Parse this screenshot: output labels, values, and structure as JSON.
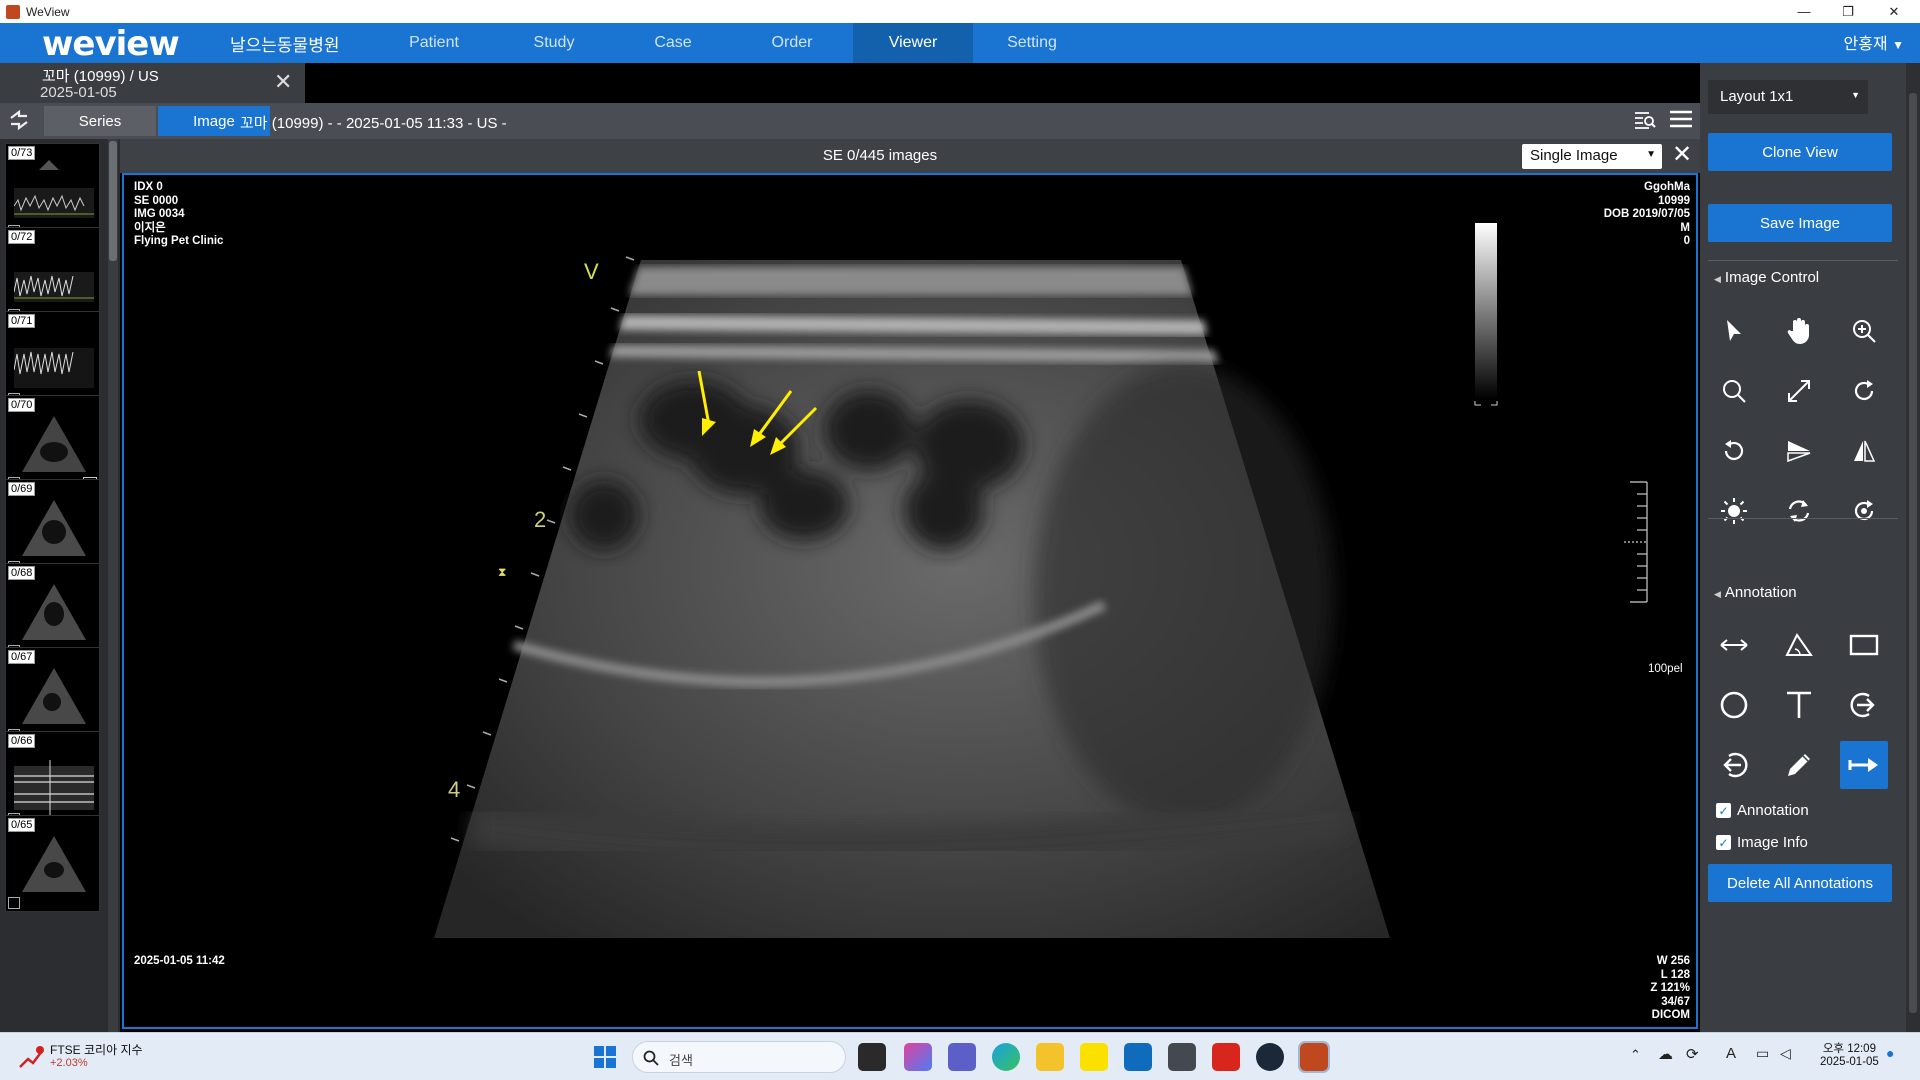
{
  "window": {
    "title": "WeView",
    "min": "—",
    "max": "❐",
    "close": "✕"
  },
  "nav": {
    "logo": "weview",
    "hospital": "날으는동물병원",
    "items": [
      {
        "label": "Patient"
      },
      {
        "label": "Study"
      },
      {
        "label": "Case"
      },
      {
        "label": "Order"
      },
      {
        "label": "Viewer"
      },
      {
        "label": "Setting"
      }
    ],
    "active": "Viewer",
    "user": "안홍재"
  },
  "study_tab": {
    "patient": "꼬마 (10999) / US",
    "date": "2025-01-05",
    "close": "✕"
  },
  "toolbar": {
    "tab_series": "Series",
    "tab_image": "Image",
    "title": "꼬마 (10999) -  - 2025-01-05 11:33 - US -"
  },
  "thumbnails": [
    {
      "label": "0/73",
      "kind": "doppler"
    },
    {
      "label": "0/72",
      "kind": "doppler"
    },
    {
      "label": "0/71",
      "kind": "doppler"
    },
    {
      "label": "0/70",
      "kind": "sector"
    },
    {
      "label": "0/69",
      "kind": "sector"
    },
    {
      "label": "0/68",
      "kind": "sector"
    },
    {
      "label": "0/67",
      "kind": "sector"
    },
    {
      "label": "0/66",
      "kind": "mmode"
    },
    {
      "label": "0/65",
      "kind": "sector"
    }
  ],
  "viewer": {
    "series_info": "SE 0/445 images",
    "mode_select": "Single Image",
    "close": "✕"
  },
  "overlay": {
    "top_left": [
      "IDX 0",
      "SE 0000",
      "IMG 0034",
      "이지은",
      "Flying Pet Clinic"
    ],
    "top_right": [
      "GgohMa",
      "10999",
      "DOB 2019/07/05",
      "M",
      "0"
    ],
    "bottom_left": "2025-01-05 11:42",
    "bottom_right": [
      "W 256",
      "L 128",
      "Z 121%",
      "34/67",
      "DICOM"
    ],
    "scale_label": "100pel",
    "probe_marker": "V",
    "depth_2": "2",
    "depth_4": "4"
  },
  "right_panel": {
    "layout": "Layout 1x1",
    "clone_view": "Clone View",
    "save_image": "Save Image",
    "image_control_title": "Image Control",
    "image_tools": [
      "pointer-icon",
      "pan-hand-icon",
      "zoom-in-icon",
      "magnifier-icon",
      "fit-expand-icon",
      "rotate-cw-icon",
      "rotate-ccw-icon",
      "flip-horizontal-icon",
      "flip-vertical-icon",
      "brightness-icon",
      "reset-icon",
      "invert-icon"
    ],
    "annotation_title": "Annotation",
    "annotation_tools": [
      "ruler-icon",
      "angle-icon",
      "rectangle-icon",
      "ellipse-icon",
      "text-icon",
      "arrow-right-circle-icon",
      "arrow-left-circle-icon",
      "pencil-icon",
      "arrow-icon"
    ],
    "active_annotation_tool": "arrow-icon",
    "chk_annotation": "Annotation",
    "chk_image_info": "Image Info",
    "delete_all": "Delete All Annotations"
  },
  "taskbar": {
    "stock_name": "FTSE 코리아 지수",
    "stock_change": "+2.03%",
    "search_placeholder": "검색",
    "time": "오후 12:09",
    "date": "2025-01-05"
  },
  "colors": {
    "accent": "#1a75d2",
    "arrow": "#ffee00",
    "panel": "#3a3d42"
  }
}
